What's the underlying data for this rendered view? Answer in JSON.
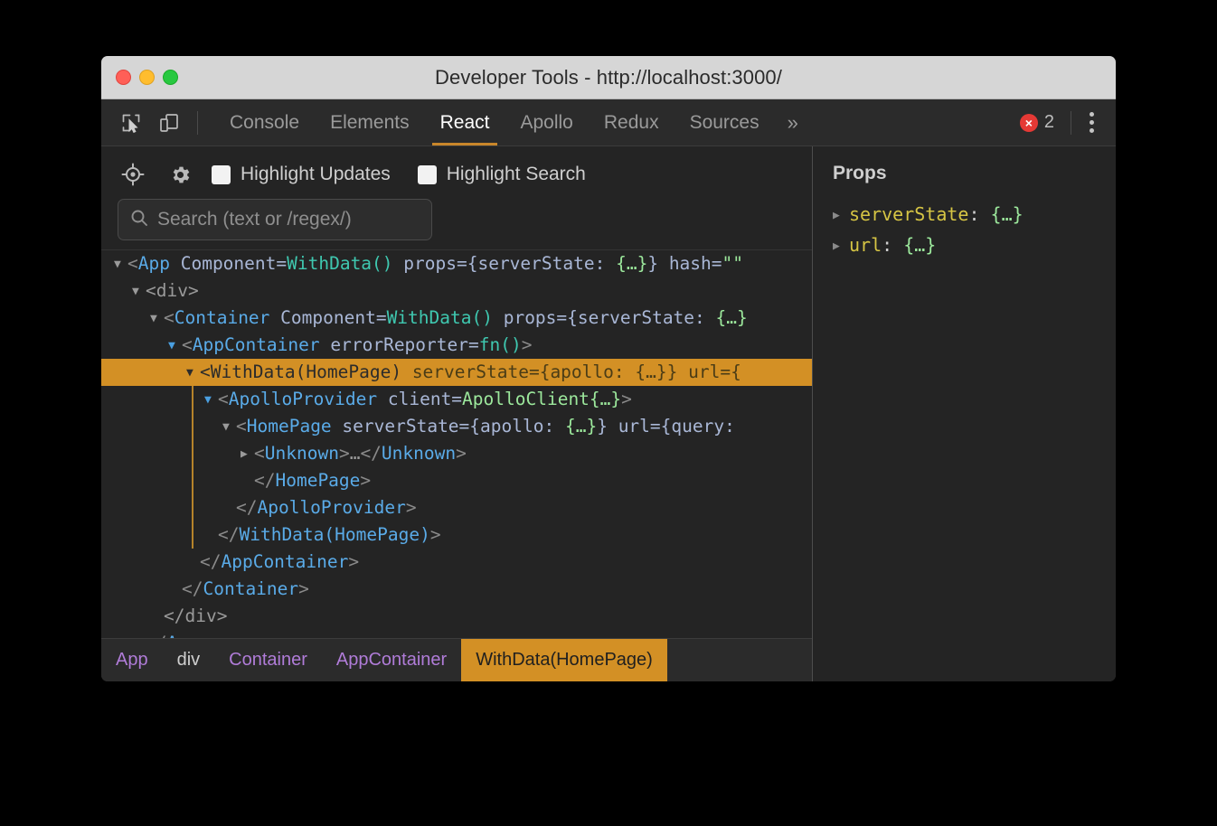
{
  "window": {
    "title": "Developer Tools - http://localhost:3000/",
    "traffic_lights": [
      "close-button",
      "minimize-button",
      "maximize-button"
    ]
  },
  "tabbar": {
    "icons": [
      "inspect-element-icon",
      "device-toolbar-icon"
    ],
    "tabs": [
      {
        "label": "Console",
        "active": false
      },
      {
        "label": "Elements",
        "active": false
      },
      {
        "label": "React",
        "active": true
      },
      {
        "label": "Apollo",
        "active": false
      },
      {
        "label": "Redux",
        "active": false
      },
      {
        "label": "Sources",
        "active": false
      }
    ],
    "more_label": "»",
    "error_badge": {
      "icon": "×",
      "count": "2",
      "color": "#e53935"
    },
    "menu_icon": "kebab-menu-icon",
    "active_underline_color": "#c9862a"
  },
  "react_toolbar": {
    "icons": [
      "target-selector-icon",
      "settings-gear-icon"
    ],
    "checkboxes": [
      {
        "label": "Highlight Updates",
        "checked": false
      },
      {
        "label": "Highlight Search",
        "checked": false
      }
    ],
    "search": {
      "placeholder": "Search (text or /regex/)",
      "value": "",
      "icon": "search-icon"
    }
  },
  "tree": {
    "rows": [
      {
        "indent": 0,
        "arrow": "down",
        "arrow_color": "grey",
        "selected": false,
        "tokens": [
          {
            "t": "punct",
            "v": "<"
          },
          {
            "t": "tag",
            "v": "App"
          },
          {
            "t": "prop",
            "v": " Component="
          },
          {
            "t": "val",
            "v": "WithData()"
          },
          {
            "t": "prop",
            "v": " props="
          },
          {
            "t": "prop",
            "v": "{serverState: "
          },
          {
            "t": "obj",
            "v": "{…}"
          },
          {
            "t": "prop",
            "v": "}"
          },
          {
            "t": "prop",
            "v": " hash="
          },
          {
            "t": "obj",
            "v": "\"\""
          }
        ]
      },
      {
        "indent": 1,
        "arrow": "down",
        "arrow_color": "grey",
        "selected": false,
        "tokens": [
          {
            "t": "div",
            "v": "<div>"
          }
        ]
      },
      {
        "indent": 2,
        "arrow": "down",
        "arrow_color": "grey",
        "selected": false,
        "tokens": [
          {
            "t": "punct",
            "v": "<"
          },
          {
            "t": "tag",
            "v": "Container"
          },
          {
            "t": "prop",
            "v": " Component="
          },
          {
            "t": "val",
            "v": "WithData()"
          },
          {
            "t": "prop",
            "v": " props="
          },
          {
            "t": "prop",
            "v": "{serverState: "
          },
          {
            "t": "obj",
            "v": "{…}"
          }
        ]
      },
      {
        "indent": 3,
        "arrow": "down",
        "arrow_color": "blue",
        "selected": false,
        "tokens": [
          {
            "t": "punct",
            "v": "<"
          },
          {
            "t": "tag",
            "v": "AppContainer"
          },
          {
            "t": "prop",
            "v": " errorReporter="
          },
          {
            "t": "val",
            "v": "fn()"
          },
          {
            "t": "punct",
            "v": ">"
          }
        ]
      },
      {
        "indent": 4,
        "arrow": "down",
        "arrow_color": "grey",
        "selected": true,
        "tokens": [
          {
            "t": "punct",
            "v": "<"
          },
          {
            "t": "tag",
            "v": "WithData(HomePage)"
          },
          {
            "t": "prop",
            "v": " serverState="
          },
          {
            "t": "prop",
            "v": "{apollo: "
          },
          {
            "t": "obj",
            "v": "{…}"
          },
          {
            "t": "prop",
            "v": "}"
          },
          {
            "t": "prop",
            "v": " url="
          },
          {
            "t": "prop",
            "v": "{"
          }
        ]
      },
      {
        "indent": 5,
        "arrow": "down",
        "arrow_color": "blue",
        "selected": false,
        "guide": true,
        "tokens": [
          {
            "t": "punct",
            "v": "<"
          },
          {
            "t": "tag",
            "v": "ApolloProvider"
          },
          {
            "t": "prop",
            "v": " client="
          },
          {
            "t": "obj",
            "v": "ApolloClient{…}"
          },
          {
            "t": "punct",
            "v": ">"
          }
        ]
      },
      {
        "indent": 6,
        "arrow": "down",
        "arrow_color": "grey",
        "selected": false,
        "guide": true,
        "tokens": [
          {
            "t": "punct",
            "v": "<"
          },
          {
            "t": "tag",
            "v": "HomePage"
          },
          {
            "t": "prop",
            "v": " serverState="
          },
          {
            "t": "prop",
            "v": "{apollo: "
          },
          {
            "t": "obj",
            "v": "{…}"
          },
          {
            "t": "prop",
            "v": "}"
          },
          {
            "t": "prop",
            "v": " url="
          },
          {
            "t": "prop",
            "v": "{query: "
          }
        ]
      },
      {
        "indent": 7,
        "arrow": "right",
        "arrow_color": "grey",
        "selected": false,
        "guide": true,
        "tokens": [
          {
            "t": "punct",
            "v": "<"
          },
          {
            "t": "tag",
            "v": "Unknown"
          },
          {
            "t": "punct",
            "v": ">"
          },
          {
            "t": "div",
            "v": "…"
          },
          {
            "t": "punct",
            "v": "</"
          },
          {
            "t": "tag",
            "v": "Unknown"
          },
          {
            "t": "punct",
            "v": ">"
          }
        ]
      },
      {
        "indent": 7,
        "arrow": "none",
        "arrow_color": "grey",
        "selected": false,
        "guide": true,
        "tokens": [
          {
            "t": "punct",
            "v": "</"
          },
          {
            "t": "tag",
            "v": "HomePage"
          },
          {
            "t": "punct",
            "v": ">"
          }
        ]
      },
      {
        "indent": 6,
        "arrow": "none",
        "arrow_color": "grey",
        "selected": false,
        "guide": true,
        "tokens": [
          {
            "t": "punct",
            "v": "</"
          },
          {
            "t": "tag",
            "v": "ApolloProvider"
          },
          {
            "t": "punct",
            "v": ">"
          }
        ]
      },
      {
        "indent": 5,
        "arrow": "none",
        "arrow_color": "grey",
        "selected": false,
        "guide": true,
        "tokens": [
          {
            "t": "punct",
            "v": "</"
          },
          {
            "t": "tag",
            "v": "WithData(HomePage)"
          },
          {
            "t": "punct",
            "v": ">"
          }
        ]
      },
      {
        "indent": 4,
        "arrow": "none",
        "arrow_color": "grey",
        "selected": false,
        "tokens": [
          {
            "t": "punct",
            "v": "</"
          },
          {
            "t": "tag",
            "v": "AppContainer"
          },
          {
            "t": "punct",
            "v": ">"
          }
        ]
      },
      {
        "indent": 3,
        "arrow": "none",
        "arrow_color": "grey",
        "selected": false,
        "tokens": [
          {
            "t": "punct",
            "v": "</"
          },
          {
            "t": "tag",
            "v": "Container"
          },
          {
            "t": "punct",
            "v": ">"
          }
        ]
      },
      {
        "indent": 2,
        "arrow": "none",
        "arrow_color": "grey",
        "selected": false,
        "tokens": [
          {
            "t": "div",
            "v": "</div>"
          }
        ]
      },
      {
        "indent": 1,
        "arrow": "none",
        "arrow_color": "grey",
        "selected": false,
        "tokens": [
          {
            "t": "punct",
            "v": "</"
          },
          {
            "t": "tag",
            "v": "App"
          },
          {
            "t": "punct",
            "v": ">"
          }
        ]
      }
    ]
  },
  "breadcrumb": {
    "items": [
      {
        "label": "App",
        "style": "component",
        "active": false
      },
      {
        "label": "div",
        "style": "plain",
        "active": false
      },
      {
        "label": "Container",
        "style": "component",
        "active": false
      },
      {
        "label": "AppContainer",
        "style": "component",
        "active": false
      },
      {
        "label": "WithData(HomePage)",
        "style": "component",
        "active": true
      }
    ]
  },
  "props_panel": {
    "title": "Props",
    "rows": [
      {
        "arrow": "right",
        "key": "serverState",
        "colon": ": ",
        "value": "{…}"
      },
      {
        "arrow": "right",
        "key": "url",
        "colon": ": ",
        "value": "{…}"
      }
    ]
  },
  "colors": {
    "accent_orange": "#d39025",
    "tab_underline": "#c9862a",
    "error_red": "#e53935",
    "tag_blue": "#5aabe8",
    "value_teal": "#3fc8b0",
    "object_green": "#9ce89c",
    "prop_periwinkle": "#a9b7d6",
    "breadcrumb_purple": "#b07cd8",
    "panel_bg": "#242424"
  }
}
